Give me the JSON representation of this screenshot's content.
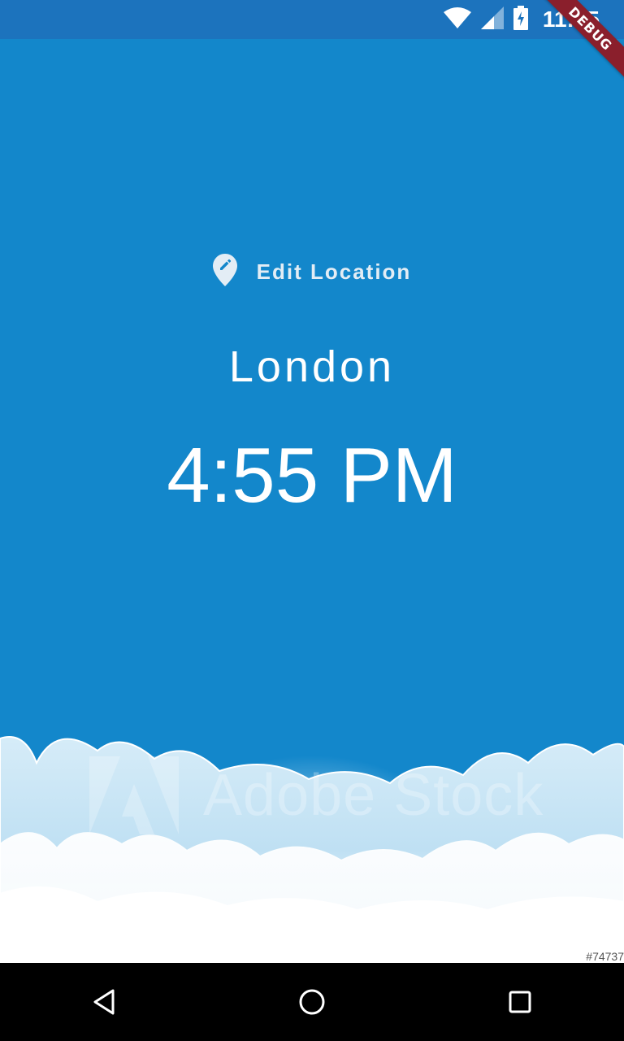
{
  "status_bar": {
    "time": "11:55",
    "icons": [
      "wifi-icon",
      "cell-signal-icon",
      "battery-charging-icon"
    ]
  },
  "debug_banner": {
    "label": "DEBUG"
  },
  "location_button": {
    "label": "Edit Location",
    "icon": "edit-location-icon"
  },
  "location": {
    "city": "London",
    "time": "4:55 PM"
  },
  "background": {
    "watermark_text": "Adobe Stock",
    "image_id": "#74737"
  },
  "nav_bar": {
    "buttons": [
      "back-icon",
      "home-icon",
      "recents-icon"
    ]
  },
  "colors": {
    "app_background": "#1387cb",
    "status_bar": "#1c73bd",
    "debug_banner": "#8a1f2c",
    "text": "#ffffff"
  }
}
